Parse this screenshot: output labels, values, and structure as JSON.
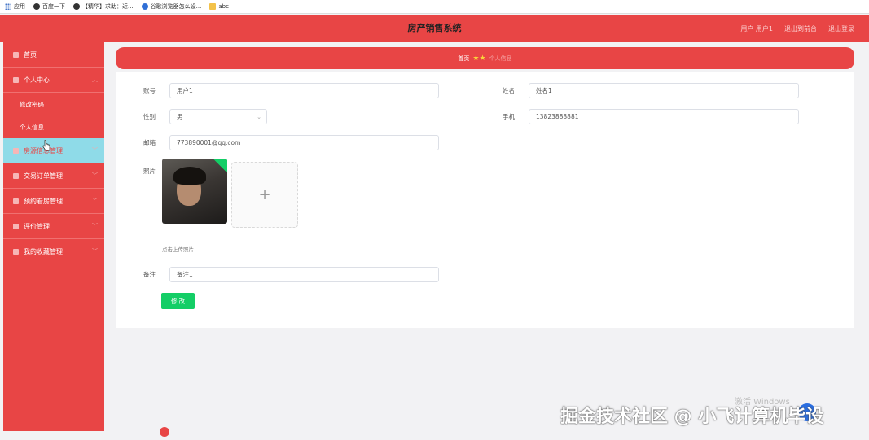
{
  "bookmarks": [
    {
      "icon": "apps-icon",
      "label": "应用"
    },
    {
      "icon": "globe-icon",
      "label": "百度一下"
    },
    {
      "icon": "globe-icon",
      "label": "【精华】求助：近..."
    },
    {
      "icon": "paw-icon",
      "label": "谷歌浏览器怎么设..."
    },
    {
      "icon": "folder-icon",
      "label": "abc"
    }
  ],
  "header": {
    "title": "房产销售系统",
    "user": "用户 用户1",
    "back_to_home": "退出到前台",
    "logout": "退出登录"
  },
  "sidebar": {
    "home": "首页",
    "personal_center": "个人中心",
    "change_password": "修改密码",
    "personal_info": "个人信息",
    "house_manage": "房源信息管理",
    "order_manage": "交易订单管理",
    "appointment_manage": "预约看房管理",
    "review_manage": "评价管理",
    "favorite_manage": "我的收藏管理"
  },
  "breadcrumb": {
    "home": "首页",
    "current": "个人信息"
  },
  "form": {
    "account_label": "账号",
    "account_value": "用户1",
    "name_label": "姓名",
    "name_value": "姓名1",
    "gender_label": "性别",
    "gender_value": "男",
    "phone_label": "手机",
    "phone_value": "13823888881",
    "email_label": "邮箱",
    "email_value": "773890001@qq.com",
    "photo_label": "照片",
    "upload_plus": "+",
    "upload_tip": "点击上传照片",
    "remark_label": "备注",
    "remark_value": "备注1",
    "submit": "修 改"
  },
  "overlay": {
    "watermark": "掘金技术社区 @ 小飞计算机毕设",
    "windows": "激活 Windows"
  },
  "colors": {
    "primary": "#e84545",
    "active_menu": "#8fdbe8",
    "success": "#13ce66"
  }
}
